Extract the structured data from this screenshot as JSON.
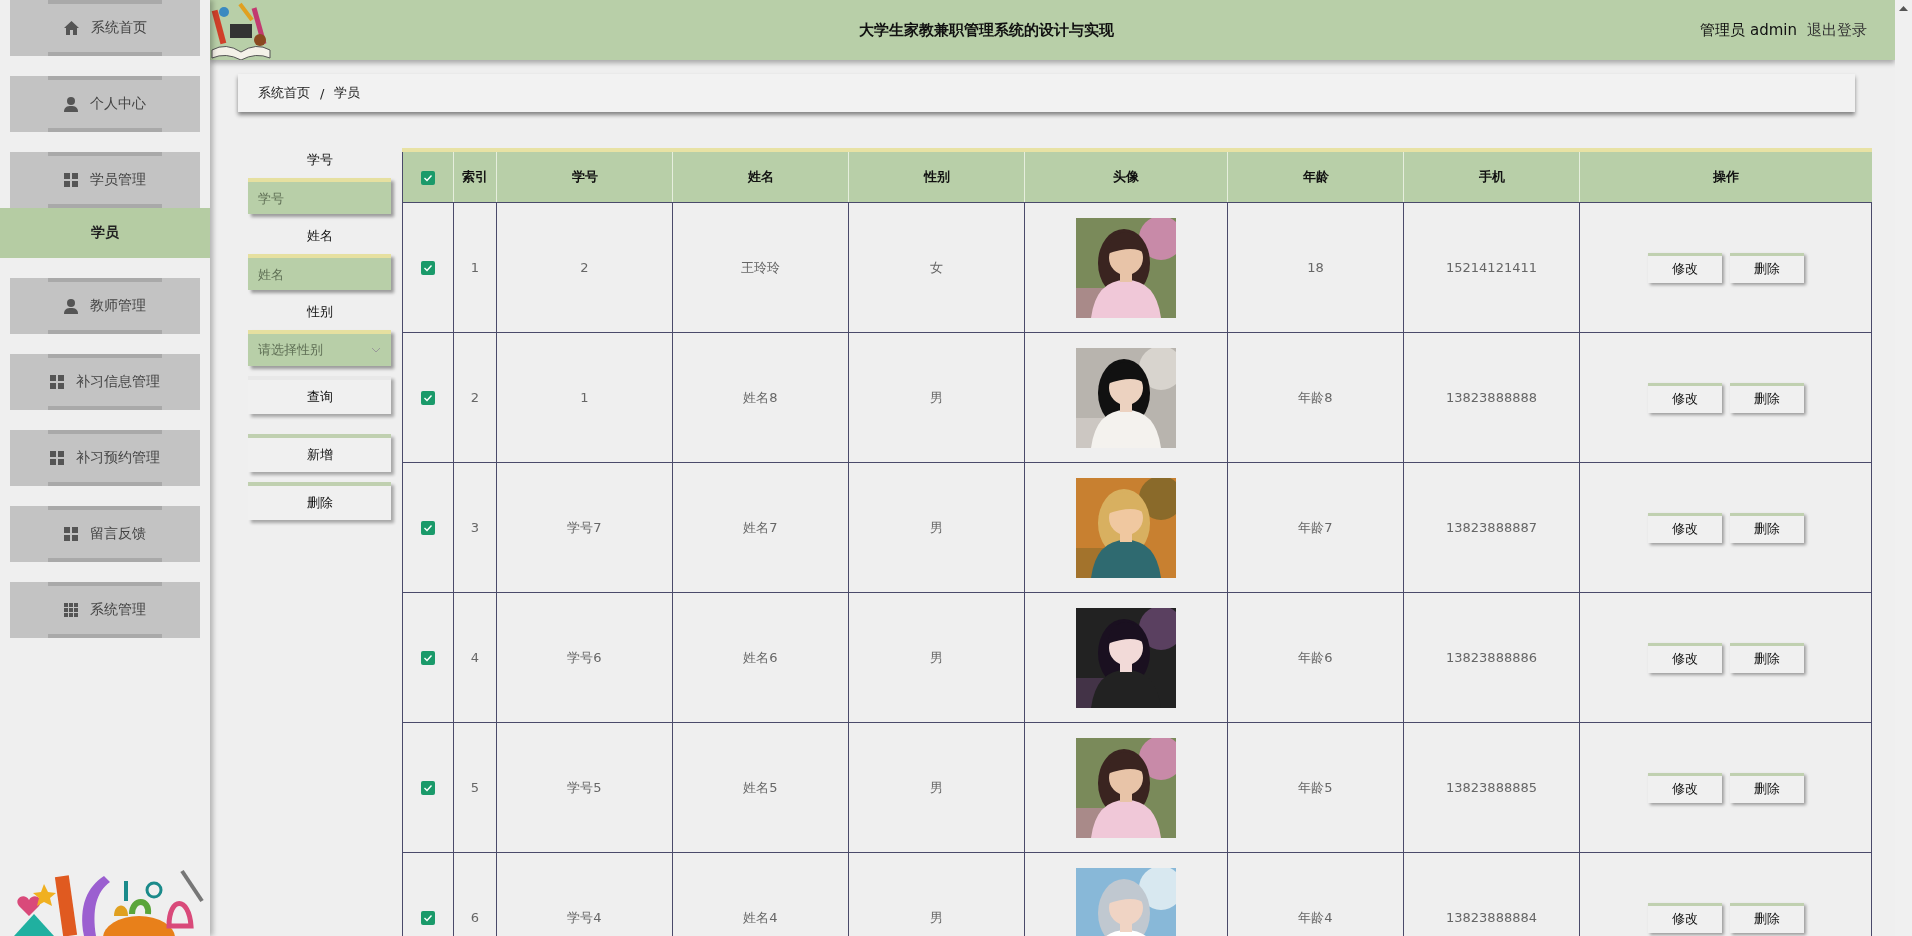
{
  "sidebar": {
    "items": [
      {
        "label": "系统首页",
        "selected": false
      },
      {
        "label": "个人中心",
        "selected": false
      },
      {
        "label": "学员管理",
        "selected": false,
        "children": [
          {
            "label": "学员",
            "selected": true
          }
        ]
      },
      {
        "label": "教师管理",
        "selected": false
      },
      {
        "label": "补习信息管理",
        "selected": false
      },
      {
        "label": "补习预约管理",
        "selected": false
      },
      {
        "label": "留言反馈",
        "selected": false
      },
      {
        "label": "系统管理",
        "selected": false
      }
    ]
  },
  "header": {
    "title": "大学生家教兼职管理系统的设计与实现",
    "user": "管理员 admin",
    "logout": "退出登录"
  },
  "breadcrumb": {
    "items": [
      "系统首页",
      "学员"
    ],
    "separator": "/"
  },
  "search": {
    "fields": [
      {
        "kind": "input",
        "label": "学号",
        "placeholder": "学号"
      },
      {
        "kind": "input",
        "label": "姓名",
        "placeholder": "姓名"
      },
      {
        "kind": "select",
        "label": "性别",
        "placeholder": "请选择性别"
      }
    ],
    "buttons": [
      "查询",
      "新增",
      "删除"
    ]
  },
  "table": {
    "all_checked": true,
    "columns": [
      "索引",
      "学号",
      "姓名",
      "性别",
      "头像",
      "年龄",
      "手机",
      "操作"
    ],
    "rows": [
      {
        "checked": true,
        "index": "1",
        "student_no": "2",
        "name": "王玲玲",
        "gender": "女",
        "age": "18",
        "phone": "15214121411",
        "actions": [
          "修改",
          "删除"
        ]
      },
      {
        "checked": true,
        "index": "2",
        "student_no": "1",
        "name": "姓名8",
        "gender": "男",
        "age": "年龄8",
        "phone": "13823888888",
        "actions": [
          "修改",
          "删除"
        ]
      },
      {
        "checked": true,
        "index": "3",
        "student_no": "学号7",
        "name": "姓名7",
        "gender": "男",
        "age": "年龄7",
        "phone": "13823888887",
        "actions": [
          "修改",
          "删除"
        ]
      },
      {
        "checked": true,
        "index": "4",
        "student_no": "学号6",
        "name": "姓名6",
        "gender": "男",
        "age": "年龄6",
        "phone": "13823888886",
        "actions": [
          "修改",
          "删除"
        ]
      },
      {
        "checked": true,
        "index": "5",
        "student_no": "学号5",
        "name": "姓名5",
        "gender": "男",
        "age": "年龄5",
        "phone": "13823888885",
        "actions": [
          "修改",
          "删除"
        ]
      },
      {
        "checked": true,
        "index": "6",
        "student_no": "学号4",
        "name": "姓名4",
        "gender": "男",
        "age": "年龄4",
        "phone": "13823888884",
        "actions": [
          "修改",
          "删除"
        ]
      }
    ]
  }
}
